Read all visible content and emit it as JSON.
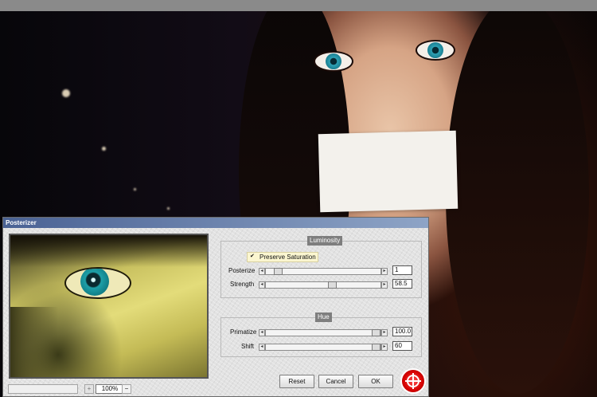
{
  "dialog": {
    "title": "Posterizer",
    "zoom": {
      "value": "100%",
      "minus_label": "−",
      "plus_label": "+"
    },
    "luminosity": {
      "title": "Luminosity",
      "preserve_saturation": {
        "label": "Preserve Saturation",
        "checked": true
      },
      "posterize": {
        "label": "Posterize",
        "value": "1",
        "left_arrow": "◂",
        "right_arrow": "▸"
      },
      "strength": {
        "label": "Strength",
        "value": "58.5",
        "left_arrow": "◂",
        "right_arrow": "▸"
      }
    },
    "hue": {
      "title": "Hue",
      "primatize": {
        "label": "Primatize",
        "value": "100.0",
        "left_arrow": "◂",
        "right_arrow": "▸"
      },
      "shift": {
        "label": "Shift",
        "value": "60",
        "left_arrow": "◂",
        "right_arrow": "▸"
      }
    },
    "buttons": {
      "reset": "Reset",
      "cancel": "Cancel",
      "ok": "OK"
    },
    "check_mark": "✔"
  },
  "colors": {
    "titlebar": "#4a6294",
    "logo": "#d60000",
    "preview_tint": "#e3dc7a"
  },
  "icons": {
    "logo": "lifebuoy-icon"
  }
}
